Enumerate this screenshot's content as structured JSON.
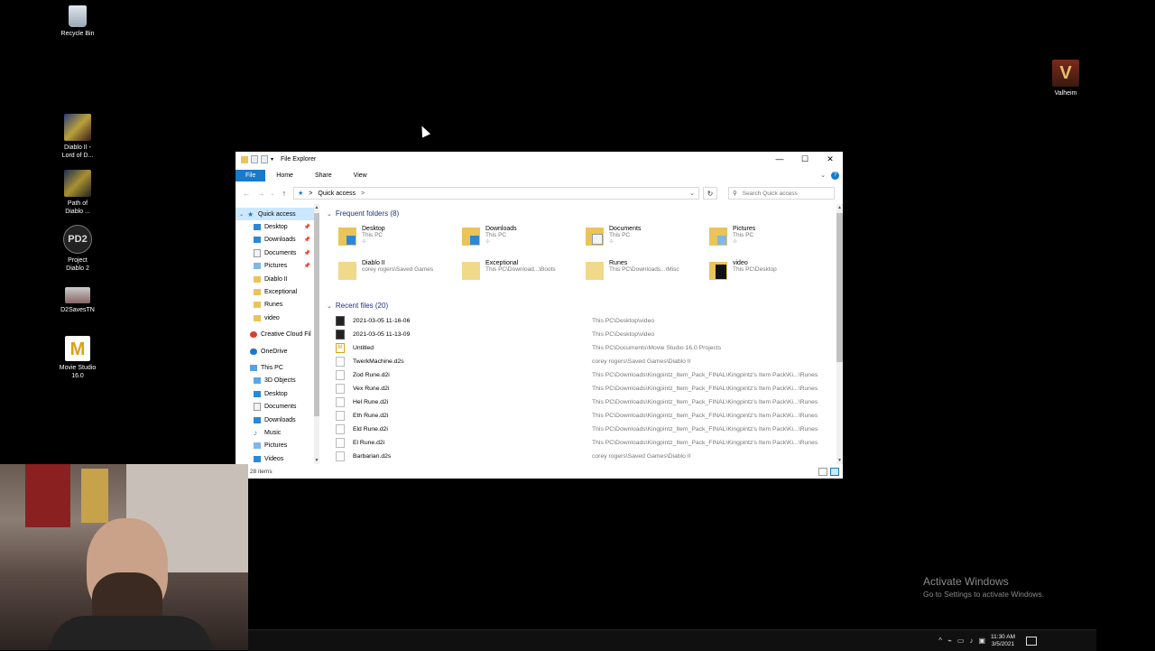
{
  "desktop": {
    "icons": [
      {
        "label": "Recycle Bin"
      },
      {
        "label": "Diablo II - Lord of D..."
      },
      {
        "label": "Path of Diablo ..."
      },
      {
        "label": "Project Diablo 2",
        "glyph": "PD2"
      },
      {
        "label": "D2SavesTN"
      },
      {
        "label": "Movie Studio 16.0",
        "glyph": "M"
      },
      {
        "label": "Valheim",
        "glyph": "V"
      }
    ]
  },
  "explorer": {
    "title": "File Explorer",
    "controls": {
      "minimize": "—",
      "maximize": "☐",
      "close": "✕"
    },
    "ribbon": {
      "file": "File",
      "home": "Home",
      "share": "Share",
      "view": "View",
      "help": "?"
    },
    "address": {
      "back": "←",
      "forward": "→",
      "up": "↑",
      "location": "Quick access",
      "sep": ">",
      "drop": "⌄",
      "refresh": "↻"
    },
    "search": {
      "placeholder": "Search Quick access",
      "icon": "⚲"
    },
    "sidebar": {
      "quick_access": "Quick access",
      "items": [
        {
          "label": "Desktop",
          "pinned": true
        },
        {
          "label": "Downloads",
          "pinned": true
        },
        {
          "label": "Documents",
          "pinned": true
        },
        {
          "label": "Pictures",
          "pinned": true
        },
        {
          "label": "Diablo II"
        },
        {
          "label": "Exceptional"
        },
        {
          "label": "Runes"
        },
        {
          "label": "video"
        },
        {
          "label": "Creative Cloud Fil"
        },
        {
          "label": "OneDrive"
        },
        {
          "label": "This PC"
        },
        {
          "label": "3D Objects"
        },
        {
          "label": "Desktop"
        },
        {
          "label": "Documents"
        },
        {
          "label": "Downloads"
        },
        {
          "label": "Music"
        },
        {
          "label": "Pictures"
        },
        {
          "label": "Videos"
        }
      ]
    },
    "frequent": {
      "header": "Frequent folders (8)",
      "folders": [
        {
          "name": "Desktop",
          "sub": "This PC",
          "pinned": true
        },
        {
          "name": "Downloads",
          "sub": "This PC",
          "pinned": true
        },
        {
          "name": "Documents",
          "sub": "This PC",
          "pinned": true
        },
        {
          "name": "Pictures",
          "sub": "This PC",
          "pinned": true
        },
        {
          "name": "Diablo II",
          "sub": "corey rogers\\Saved Games"
        },
        {
          "name": "Exceptional",
          "sub": "This PC\\Download...\\Boots"
        },
        {
          "name": "Runes",
          "sub": "This PC\\Downloads...\\Misc"
        },
        {
          "name": "video",
          "sub": "This PC\\Desktop"
        }
      ]
    },
    "recent": {
      "header": "Recent files (20)",
      "files": [
        {
          "name": "2021-03-05 11-16-06",
          "path": "This PC\\Desktop\\video"
        },
        {
          "name": "2021-03-05 11-13-09",
          "path": "This PC\\Desktop\\video"
        },
        {
          "name": "Untitled",
          "path": "This PC\\Documents\\Movie Studio 16.0 Projects"
        },
        {
          "name": "TwerkMachine.d2s",
          "path": "corey rogers\\Saved Games\\Diablo II"
        },
        {
          "name": "Zod Rune.d2i",
          "path": "This PC\\Downloads\\Kingpintz_Item_Pack_FINAL\\Kingpintz's Item Pack\\Ki...\\Runes"
        },
        {
          "name": "Vex Rune.d2i",
          "path": "This PC\\Downloads\\Kingpintz_Item_Pack_FINAL\\Kingpintz's Item Pack\\Ki...\\Runes"
        },
        {
          "name": "Hel Rune.d2i",
          "path": "This PC\\Downloads\\Kingpintz_Item_Pack_FINAL\\Kingpintz's Item Pack\\Ki...\\Runes"
        },
        {
          "name": "Eth Rune.d2i",
          "path": "This PC\\Downloads\\Kingpintz_Item_Pack_FINAL\\Kingpintz's Item Pack\\Ki...\\Runes"
        },
        {
          "name": "Eld Rune.d2i",
          "path": "This PC\\Downloads\\Kingpintz_Item_Pack_FINAL\\Kingpintz's Item Pack\\Ki...\\Runes"
        },
        {
          "name": "El Rune.d2i",
          "path": "This PC\\Downloads\\Kingpintz_Item_Pack_FINAL\\Kingpintz's Item Pack\\Ki...\\Runes"
        },
        {
          "name": "Barbarian.d2s",
          "path": "corey rogers\\Saved Games\\Diablo II"
        }
      ]
    },
    "status": "28 items"
  },
  "watermark": {
    "line1": "Activate Windows",
    "line2": "Go to Settings to activate Windows."
  },
  "taskbar": {
    "time": "11:30 AM",
    "date": "3/5/2021",
    "tray_chevron": "^"
  },
  "colors": {
    "accent": "#1979ca",
    "folder": "#e9c45a",
    "selection": "#cce8ff"
  }
}
